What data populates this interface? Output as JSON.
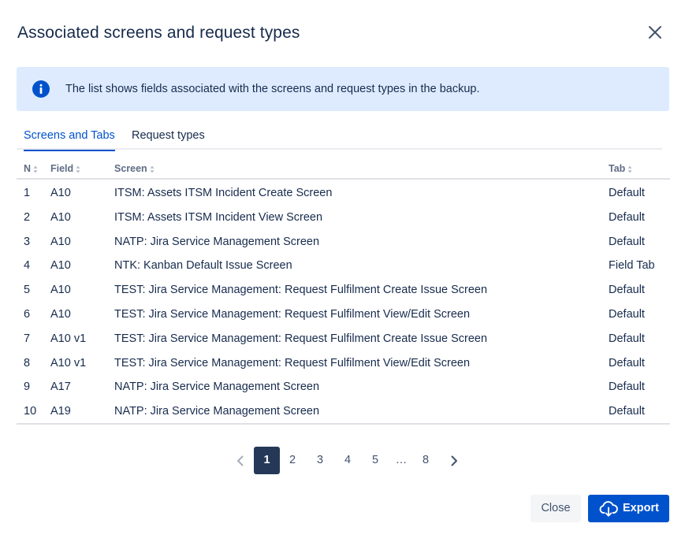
{
  "dialog": {
    "title": "Associated screens and request types",
    "close_icon": "close-icon"
  },
  "info": {
    "icon": "info-icon",
    "text": "The list shows fields associated with the screens and request types in the backup."
  },
  "tabs": [
    {
      "label": "Screens and Tabs",
      "active": true
    },
    {
      "label": "Request types",
      "active": false
    }
  ],
  "table": {
    "columns": {
      "n": "N",
      "field": "Field",
      "screen": "Screen",
      "tab": "Tab"
    },
    "rows": [
      {
        "n": "1",
        "field": "A10",
        "screen": "ITSM: Assets ITSM Incident Create Screen",
        "tab": "Default"
      },
      {
        "n": "2",
        "field": "A10",
        "screen": "ITSM: Assets ITSM Incident View Screen",
        "tab": "Default"
      },
      {
        "n": "3",
        "field": "A10",
        "screen": "NATP: Jira Service Management Screen",
        "tab": "Default"
      },
      {
        "n": "4",
        "field": "A10",
        "screen": "NTK: Kanban Default Issue Screen",
        "tab": "Field Tab"
      },
      {
        "n": "5",
        "field": "A10",
        "screen": "TEST: Jira Service Management: Request Fulfilment Create Issue Screen",
        "tab": "Default"
      },
      {
        "n": "6",
        "field": "A10",
        "screen": "TEST: Jira Service Management: Request Fulfilment View/Edit Screen",
        "tab": "Default"
      },
      {
        "n": "7",
        "field": "A10 v1",
        "screen": "TEST: Jira Service Management: Request Fulfilment Create Issue Screen",
        "tab": "Default"
      },
      {
        "n": "8",
        "field": "A10 v1",
        "screen": "TEST: Jira Service Management: Request Fulfilment View/Edit Screen",
        "tab": "Default"
      },
      {
        "n": "9",
        "field": "A17",
        "screen": "NATP: Jira Service Management Screen",
        "tab": "Default"
      },
      {
        "n": "10",
        "field": "A19",
        "screen": "NATP: Jira Service Management Screen",
        "tab": "Default"
      }
    ]
  },
  "pagination": {
    "prev_icon": "chevron-left-icon",
    "next_icon": "chevron-right-icon",
    "pages": [
      "1",
      "2",
      "3",
      "4",
      "5",
      "…",
      "8"
    ],
    "current": "1"
  },
  "footer": {
    "close_label": "Close",
    "export_label": "Export",
    "export_icon": "cloud-download-icon"
  },
  "colors": {
    "primary": "#0052cc",
    "info_bg": "#deebff",
    "active_page": "#253858"
  }
}
